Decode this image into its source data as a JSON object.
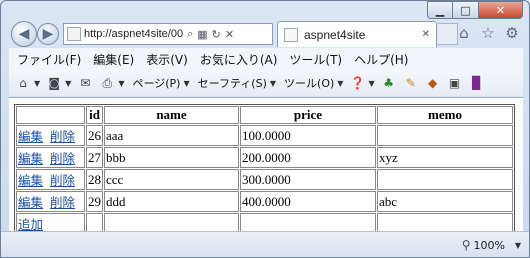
{
  "browser": {
    "address": "http://aspnet4site/00",
    "address_icons": [
      "search-icon",
      "refresh-icon",
      "stop-icon"
    ],
    "tab_title": "aspnet4site",
    "window_controls": [
      "minimize",
      "maximize",
      "close"
    ]
  },
  "menu": {
    "items": [
      "ファイル(F)",
      "編集(E)",
      "表示(V)",
      "お気に入り(A)",
      "ツール(T)",
      "ヘルプ(H)"
    ]
  },
  "commandbar": {
    "page_label": "ページ(P)",
    "safety_label": "セーフティ(S)",
    "tools_label": "ツール(O)"
  },
  "table": {
    "headers": [
      "",
      "id",
      "name",
      "price",
      "memo"
    ],
    "edit_label": "編集",
    "delete_label": "削除",
    "add_label": "追加",
    "rows": [
      {
        "id": "26",
        "name": "aaa",
        "price": "100.0000",
        "memo": ""
      },
      {
        "id": "27",
        "name": "bbb",
        "price": "200.0000",
        "memo": "xyz"
      },
      {
        "id": "28",
        "name": "ccc",
        "price": "300.0000",
        "memo": ""
      },
      {
        "id": "29",
        "name": "ddd",
        "price": "400.0000",
        "memo": "abc"
      }
    ]
  },
  "status": {
    "zoom": "100%"
  }
}
